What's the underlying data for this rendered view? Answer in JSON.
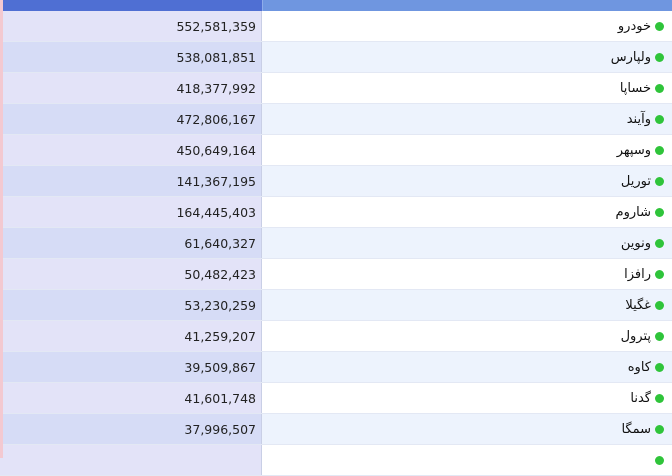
{
  "colors": {
    "header_value_bg": "#4f6fd3",
    "header_name_bg": "#6f96e0",
    "status_dot": "#2fc43a"
  },
  "icons": {
    "status": "status-dot-icon"
  },
  "table": {
    "header": {
      "value_label": "",
      "name_label": ""
    },
    "rows": [
      {
        "name": "خودرو",
        "value": "552,581,359"
      },
      {
        "name": "ولپارس",
        "value": "538,081,851"
      },
      {
        "name": "خساپا",
        "value": "418,377,992"
      },
      {
        "name": "وآیند",
        "value": "472,806,167"
      },
      {
        "name": "وسپهر",
        "value": "450,649,164"
      },
      {
        "name": "توریل",
        "value": "141,367,195"
      },
      {
        "name": "شاروم",
        "value": "164,445,403"
      },
      {
        "name": "ونوین",
        "value": "61,640,327"
      },
      {
        "name": "رافزا",
        "value": "50,482,423"
      },
      {
        "name": "غگیلا",
        "value": "53,230,259"
      },
      {
        "name": "پترول",
        "value": "41,259,207"
      },
      {
        "name": "کاوه",
        "value": "39,509,867"
      },
      {
        "name": "گدنا",
        "value": "41,601,748"
      },
      {
        "name": "سمگا",
        "value": "37,996,507"
      },
      {
        "name": "",
        "value": ""
      }
    ]
  }
}
